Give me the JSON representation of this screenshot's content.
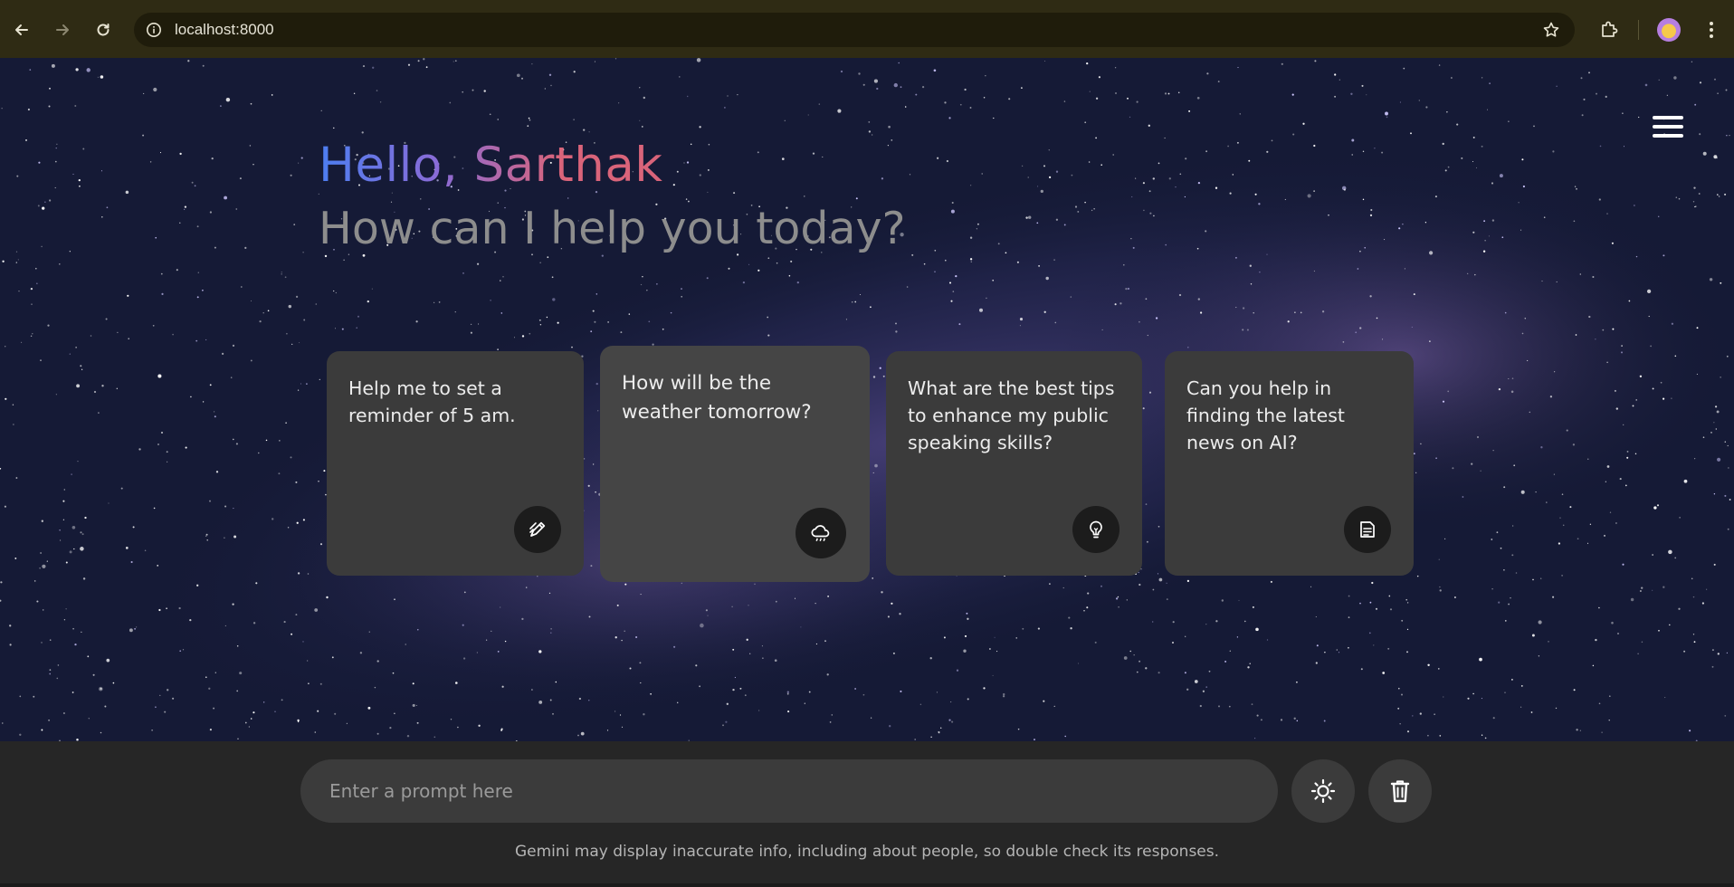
{
  "browser": {
    "url": "localhost:8000",
    "icons": [
      "back-icon",
      "forward-icon",
      "reload-icon",
      "site-info-icon",
      "bookmark-star-icon",
      "extensions-icon",
      "profile-avatar",
      "more-menu-icon"
    ]
  },
  "header": {
    "greeting": "Hello, Sarthak",
    "subtitle": "How can I help you today?",
    "menu_icon": "hamburger-menu-icon"
  },
  "suggestions": [
    {
      "text": "Help me to set a reminder of 5 am.",
      "icon": "draw-pencil-icon"
    },
    {
      "text": "How will be the weather tomorrow?",
      "icon": "cloud-rain-icon"
    },
    {
      "text": "What are the best tips to enhance my public speaking skills?",
      "icon": "lightbulb-icon"
    },
    {
      "text": "Can you help in finding the latest news on AI?",
      "icon": "document-icon"
    }
  ],
  "prompt": {
    "placeholder": "Enter a prompt here",
    "theme_icon": "sun-icon",
    "delete_icon": "trash-icon"
  },
  "disclaimer": "Gemini may display inaccurate info, including about people, so double check its responses.",
  "colors": {
    "greeting_start": "#4c7ef1",
    "greeting_end": "#d9647a",
    "card_bg": "#3b3b3b",
    "bottom_bg": "#262626"
  }
}
